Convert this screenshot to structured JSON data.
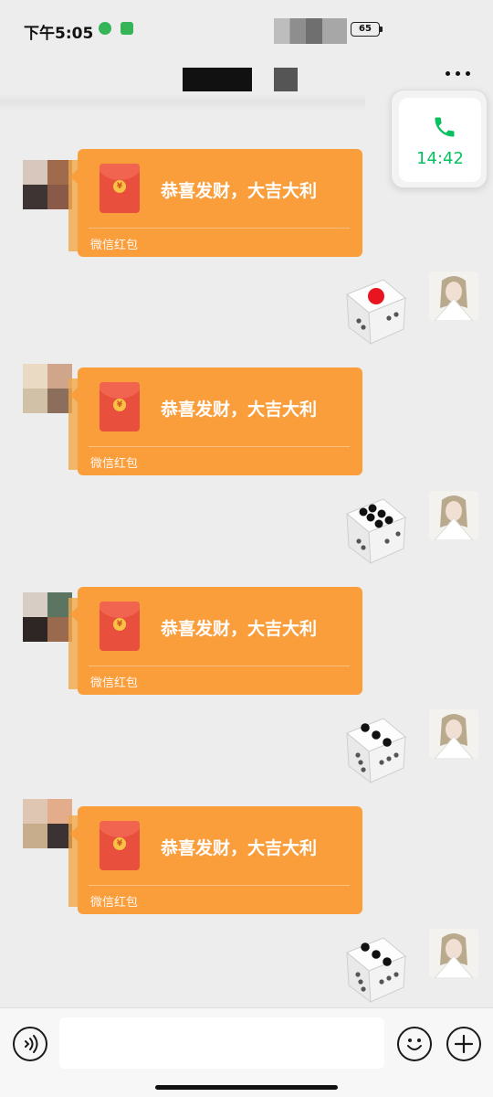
{
  "status_bar": {
    "time": "下午5:05",
    "battery": "65"
  },
  "call_widget": {
    "duration": "14:42",
    "icon": "phone-icon"
  },
  "messages": [
    {
      "type": "red_packet",
      "side": "left",
      "title": "恭喜发财，大吉大利",
      "footer": "微信红包"
    },
    {
      "type": "dice",
      "side": "right",
      "face": 1
    },
    {
      "type": "red_packet",
      "side": "left",
      "title": "恭喜发财，大吉大利",
      "footer": "微信红包"
    },
    {
      "type": "dice",
      "side": "right",
      "face": 6
    },
    {
      "type": "red_packet",
      "side": "left",
      "title": "恭喜发财，大吉大利",
      "footer": "微信红包"
    },
    {
      "type": "dice",
      "side": "right",
      "face": 3
    },
    {
      "type": "red_packet",
      "side": "left",
      "title": "恭喜发财，大吉大利",
      "footer": "微信红包"
    },
    {
      "type": "dice",
      "side": "right",
      "face": 3
    }
  ],
  "input_bar": {
    "voice_icon": "voice-icon",
    "emoji_icon": "emoji-icon",
    "plus_icon": "plus-icon"
  },
  "colors": {
    "background": "#ededed",
    "red_packet": "#fa9d3b",
    "accent": "#07c160"
  }
}
